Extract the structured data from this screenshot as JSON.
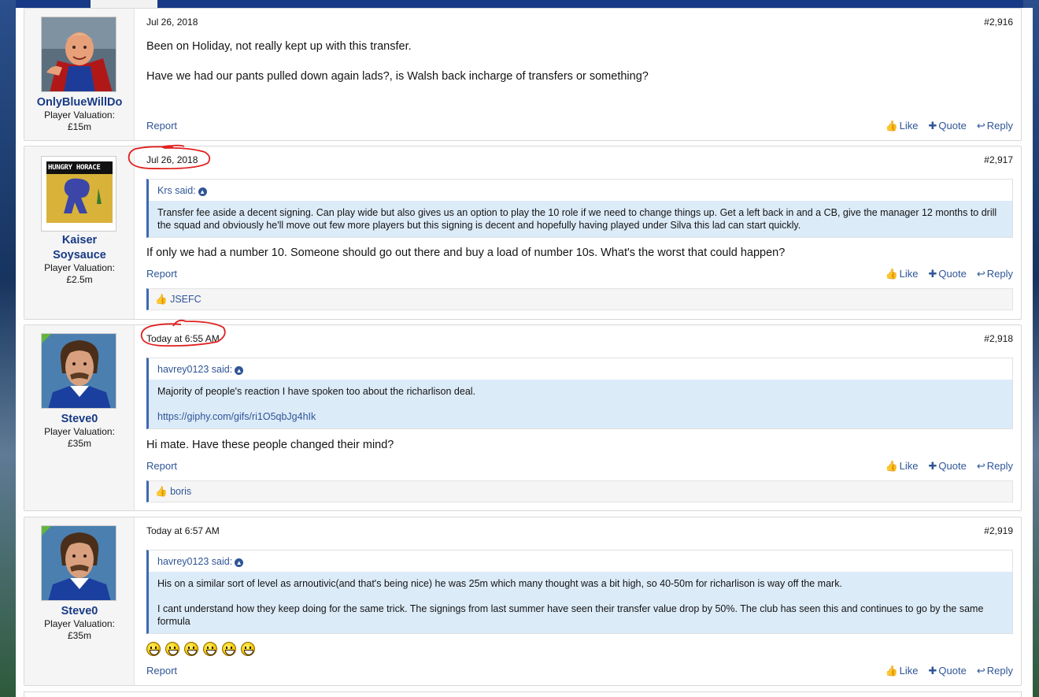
{
  "posts": [
    {
      "username": "OnlyBlueWillDo",
      "valuation_label": "Player Valuation:",
      "valuation": "£15m",
      "date": "Jul 26, 2018",
      "number": "#2,916",
      "paragraphs": [
        "Been on Holiday, not really kept up with this transfer.",
        "Have we had our pants pulled down again lads?, is Walsh back incharge of transfers or something?"
      ],
      "report": "Report"
    },
    {
      "username_line1": "Kaiser",
      "username_line2": "Soysauce",
      "avatar_text": "HUNGRY HORACE",
      "valuation_label": "Player Valuation:",
      "valuation": "£2.5m",
      "date": "Jul 26, 2018",
      "number": "#2,917",
      "quote_author": "Krs said:",
      "quote_text": "Transfer fee aside a decent signing. Can play wide but also gives us an option to play the 10 role if we need to change things up. Get a left back in and a CB, give the manager 12 months to drill the squad and obviously he'll move out few more players but this signing is decent and hopefully having played under Silva this lad can start quickly.",
      "text": "If only we had a number 10. Someone should go out there and buy a load of number 10s. What's the worst that could happen?",
      "report": "Report",
      "liked_by": "JSEFC"
    },
    {
      "username": "Steve0",
      "valuation_label": "Player Valuation:",
      "valuation": "£35m",
      "date": "Today at 6:55 AM",
      "number": "#2,918",
      "quote_author": "havrey0123 said:",
      "quote_text": "Majority of people's reaction I have spoken too about the richarlison deal.",
      "quote_link": "https://giphy.com/gifs/ri1O5qbJg4hIk",
      "text": "Hi mate. Have these people changed their mind?",
      "report": "Report",
      "liked_by": "boris"
    },
    {
      "username": "Steve0",
      "valuation_label": "Player Valuation:",
      "valuation": "£35m",
      "date": "Today at 6:57 AM",
      "number": "#2,919",
      "quote_author": "havrey0123 said:",
      "quote_para1": "His on a similar sort of level as arnoutivic(and that's being nice) he was 25m which many thought was a bit high, so 40-50m for richarlison is way off the mark.",
      "quote_para2": "I cant understand how they keep doing for the same trick. The signings from last summer have seen their transfer value drop by 50%. The club has seen this and continues to go by the same formula",
      "report": "Report"
    }
  ],
  "actions": {
    "like": "Like",
    "quote": "Quote",
    "reply": "Reply"
  },
  "colors": {
    "link": "#2f5597",
    "username": "#183a86",
    "quote_bg": "#dcebf8",
    "annotation": "#e02020"
  }
}
